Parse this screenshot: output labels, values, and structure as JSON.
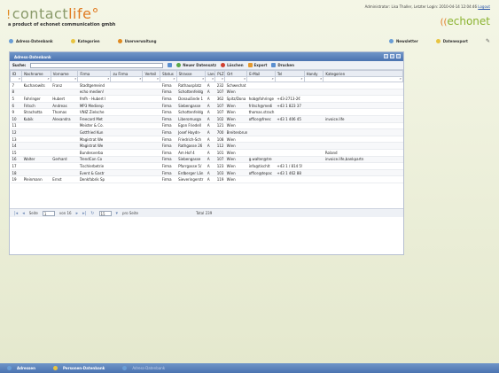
{
  "header": {
    "logo_text": "contact",
    "logo_accent": "life",
    "tagline": "a product of echonet communication gmbh",
    "admin_info": "Administrator: Lisa Thaller, Letzter Login: 2010-04-14 12:04:46",
    "logout": "Logout",
    "brand": "echonet",
    "brand_bullet": "(("
  },
  "topnav": {
    "left": [
      {
        "label": "Adress-Datenbank",
        "color": "#6a9ed6"
      },
      {
        "label": "Kategorien",
        "color": "#e8c440"
      },
      {
        "label": "Userverwaltung",
        "color": "#e08a20"
      }
    ],
    "right": [
      {
        "label": "Newsletter",
        "color": "#6a9ed6"
      },
      {
        "label": "Datenexport",
        "color": "#e8c440"
      }
    ]
  },
  "window": {
    "title": "Adress-Datenbank",
    "search_label": "Suche:",
    "search_value": "",
    "toolbar": [
      {
        "label": "Neuer Datensatz",
        "icon": "add-icon",
        "color": "green"
      },
      {
        "label": "Löschen",
        "icon": "delete-icon",
        "color": "red"
      },
      {
        "label": "Export",
        "icon": "export-icon",
        "color": "orange"
      },
      {
        "label": "Drucken",
        "icon": "print-icon",
        "color": "blue"
      }
    ],
    "columns": [
      "ID",
      "Nachname",
      "Vorname",
      "Firma",
      "zu Firma",
      "Verteil",
      "Status",
      "Strasse",
      "Land",
      "PLZ",
      "Ort",
      "E-Mail",
      "Tel",
      "Handy",
      "Kategorien"
    ],
    "rows": [
      [
        "7",
        "Kucharowits",
        "Franz",
        "Stadtgemeind",
        "",
        "",
        "Firma",
        "Rathausplatz",
        "A",
        "232",
        "Schwechat",
        "",
        "",
        "",
        ""
      ],
      [
        "8",
        "",
        "",
        "echo medien!",
        "",
        "",
        "Firma",
        "Schottenfeldg",
        "A",
        "107",
        "Wien",
        "",
        "",
        "",
        ""
      ],
      [
        "5",
        "Fohringer",
        "Hubert",
        "fmfh - Hubert I",
        "",
        "",
        "Firma",
        "Donaulände 1",
        "A",
        "362",
        "Spitz/Dona",
        "hob@fohringe",
        "+43-2713-2€",
        "",
        ""
      ],
      [
        "6",
        "Fritsch",
        "Andreas",
        "MP3 Medienp",
        "",
        "",
        "Firma",
        "Siebengasse",
        "A",
        "107",
        "Wien",
        "fritsch@medi",
        "+43 1 823 37",
        "",
        ""
      ],
      [
        "9",
        "Strachotta",
        "Thomas",
        "VNIZ Zielsche",
        "",
        "",
        "Firma",
        "Schottenfeldg",
        "A",
        "107",
        "Wien",
        "thomas.strach",
        "",
        "",
        ""
      ],
      [
        "10",
        "Kubik",
        "Alexandra",
        "Freecard Met",
        "",
        "",
        "Firma",
        "Liberomusga",
        "A",
        "102",
        "Wien",
        "office@freec",
        "+43 1 406 45",
        "",
        "invoice.life"
      ],
      [
        "11",
        "",
        "",
        "Meister & Co.",
        "",
        "",
        "Firma",
        "Egon Friedell",
        "A",
        "121",
        "Wien",
        "",
        "",
        "",
        ""
      ],
      [
        "12",
        "",
        "",
        "Gottfried Kun",
        "",
        "",
        "Firma",
        "Josef Haydn-",
        "A",
        "700",
        "Breitenbrun",
        "",
        "",
        "",
        ""
      ],
      [
        "13",
        "",
        "",
        "Magistrat We",
        "",
        "",
        "Firma",
        "Friedrich-Sch",
        "A",
        "108",
        "Wien",
        "",
        "",
        "",
        ""
      ],
      [
        "14",
        "",
        "",
        "Magistrat We",
        "",
        "",
        "Firma",
        "Rathgasse 26",
        "A",
        "112",
        "Wien",
        "",
        "",
        "",
        ""
      ],
      [
        "15",
        "",
        "",
        "Bundesverba",
        "",
        "",
        "Firma",
        "Am Hof 4",
        "A",
        "101",
        "Wien",
        "",
        "",
        "",
        "Roland"
      ],
      [
        "16",
        "Walter",
        "Gerhard",
        "TrendCon Co",
        "",
        "",
        "Firma",
        "Siebengasse",
        "A",
        "107",
        "Wien",
        "g.walter@tre",
        "",
        "",
        "invoice.life,bankpartn"
      ],
      [
        "17",
        "",
        "",
        "Tischlerbetrie",
        "",
        "",
        "Firma",
        "Pfarrgasse 5/",
        "A",
        "123",
        "Wien",
        "info@tischlt",
        "+43 1 / 814 5!",
        "",
        ""
      ],
      [
        "18",
        "",
        "",
        "Event & Gastr",
        "",
        "",
        "Firma",
        "Erdberger Län",
        "A",
        "103",
        "Wien",
        "office@tepac",
        "+43 1 462 88",
        "",
        ""
      ],
      [
        "19",
        "Pleinmann",
        "Ernst",
        "Denkfabrik Sp",
        "",
        "",
        "Firma",
        "Sieveringerstr",
        "A",
        "119",
        "Wien",
        "",
        "",
        "",
        ""
      ]
    ],
    "pager": {
      "page_label": "Seite",
      "page_value": "1",
      "of_label": "von 16",
      "per_page_value": "15",
      "per_page_label": "pro Seite",
      "total": "Total 239"
    }
  },
  "bottombar": [
    {
      "label": "Adressen",
      "active": false
    },
    {
      "label": "Personen-Datenbank",
      "active": false
    },
    {
      "label": "Adress-Datenbank",
      "active": true
    }
  ]
}
